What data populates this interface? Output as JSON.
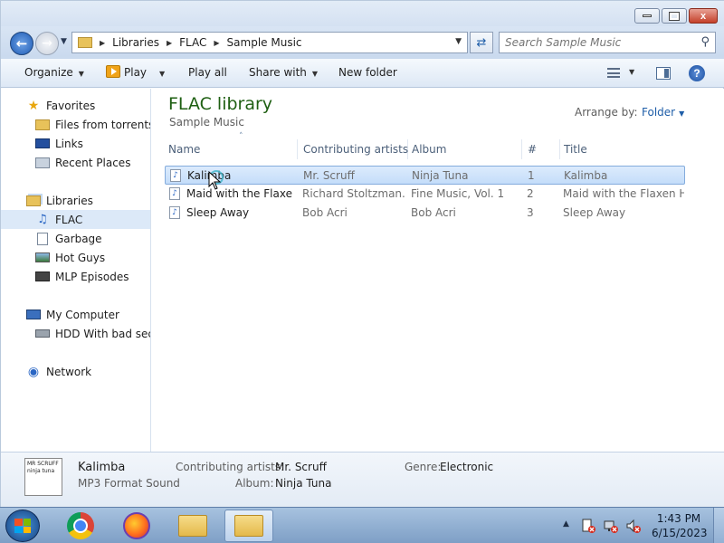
{
  "window": {
    "buttons": {
      "minimize": "—",
      "maximize": "□",
      "close": "x"
    }
  },
  "address": {
    "crumbs": [
      "Libraries",
      "FLAC",
      "Sample Music"
    ],
    "search_placeholder": "Search Sample Music"
  },
  "toolbar": {
    "organize": "Organize",
    "play": "Play",
    "play_all": "Play all",
    "share_with": "Share with",
    "new_folder": "New folder"
  },
  "nav": {
    "favorites": {
      "label": "Favorites",
      "items": [
        "Files from torrents",
        "Links",
        "Recent Places"
      ]
    },
    "libraries": {
      "label": "Libraries",
      "items": [
        "FLAC",
        "Garbage",
        "Hot Guys",
        "MLP Episodes"
      ]
    },
    "computer": {
      "label": "My Computer",
      "items": [
        "HDD With bad secto"
      ]
    },
    "network": {
      "label": "Network"
    }
  },
  "library": {
    "title": "FLAC library",
    "subtitle": "Sample Music",
    "arrange_label": "Arrange by:",
    "arrange_value": "Folder"
  },
  "columns": [
    "Name",
    "Contributing artists",
    "Album",
    "#",
    "Title"
  ],
  "rows": [
    {
      "name": "Kalimba",
      "artist": "Mr. Scruff",
      "album": "Ninja Tuna",
      "num": "1",
      "title": "Kalimba"
    },
    {
      "name": "Maid with the Flaxe...",
      "artist": "Richard Stoltzman...",
      "album": "Fine Music, Vol. 1",
      "num": "2",
      "title": "Maid with the Flaxen H..."
    },
    {
      "name": "Sleep Away",
      "artist": "Bob Acri",
      "album": "Bob Acri",
      "num": "3",
      "title": "Sleep Away"
    }
  ],
  "details": {
    "thumb_text": "MR SCRUFF ninja tuna",
    "name": "Kalimba",
    "type": "MP3 Format Sound",
    "artists_label": "Contributing artists:",
    "artists_value": "Mr. Scruff",
    "album_label": "Album:",
    "album_value": "Ninja Tuna",
    "genre_label": "Genre:",
    "genre_value": "Electronic"
  },
  "clock": {
    "time": "1:43 PM",
    "date": "6/15/2023"
  }
}
